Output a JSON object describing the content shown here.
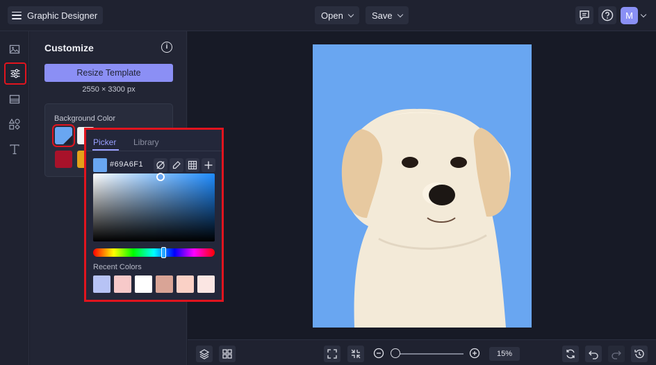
{
  "topbar": {
    "app_title": "Graphic Designer",
    "open_label": "Open",
    "save_label": "Save",
    "avatar_initial": "M"
  },
  "panel": {
    "title": "Customize",
    "resize_label": "Resize Template",
    "dimensions": "2550 × 3300 px",
    "background_label": "Background Color"
  },
  "swatches": {
    "row1": [
      "#69a6f1",
      "#f2f2f2"
    ],
    "row2": [
      "#a8122a",
      "#e3a21a"
    ]
  },
  "picker": {
    "tab_picker": "Picker",
    "tab_library": "Library",
    "hex": "#69A6F1",
    "recent_label": "Recent Colors",
    "recent_colors": [
      "#b7c3f5",
      "#f7c9c9",
      "#ffffff",
      "#d9a496",
      "#fad1c6",
      "#fbe6e3"
    ]
  },
  "bottombar": {
    "zoom": "15%"
  },
  "colors": {
    "accent": "#8b8ff5",
    "highlight": "#e1141e",
    "background_color": "#69a6f1"
  }
}
